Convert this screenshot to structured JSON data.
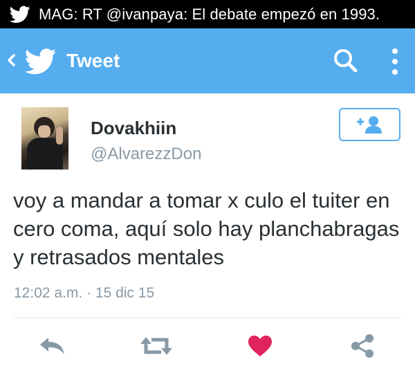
{
  "status_bar": {
    "icon": "twitter-bird-icon",
    "notification_text": "MAG: RT @ivanpaya: El debate empezó en 1993."
  },
  "app_bar": {
    "back_icon": "chevron-left-icon",
    "logo_icon": "twitter-bird-icon",
    "title": "Tweet",
    "search_icon": "search-icon",
    "more_icon": "more-vertical-icon",
    "background_color": "#55acee"
  },
  "tweet": {
    "author": {
      "display_name": "Dovakhiin",
      "username": "@AlvarezzDon",
      "avatar": "avatar-photo"
    },
    "follow_button_icon": "add-user-icon",
    "text": "voy a mandar a tomar x culo el tuiter en cero coma, aquí solo hay planchabragas y retrasados mentales",
    "timestamp": "12:02 a.m. · 15 dic 15",
    "actions": [
      {
        "name": "reply",
        "icon": "reply-icon"
      },
      {
        "name": "retweet",
        "icon": "retweet-icon"
      },
      {
        "name": "like",
        "icon": "heart-icon",
        "active": true,
        "color": "#e0245e"
      },
      {
        "name": "share",
        "icon": "share-icon"
      }
    ]
  }
}
